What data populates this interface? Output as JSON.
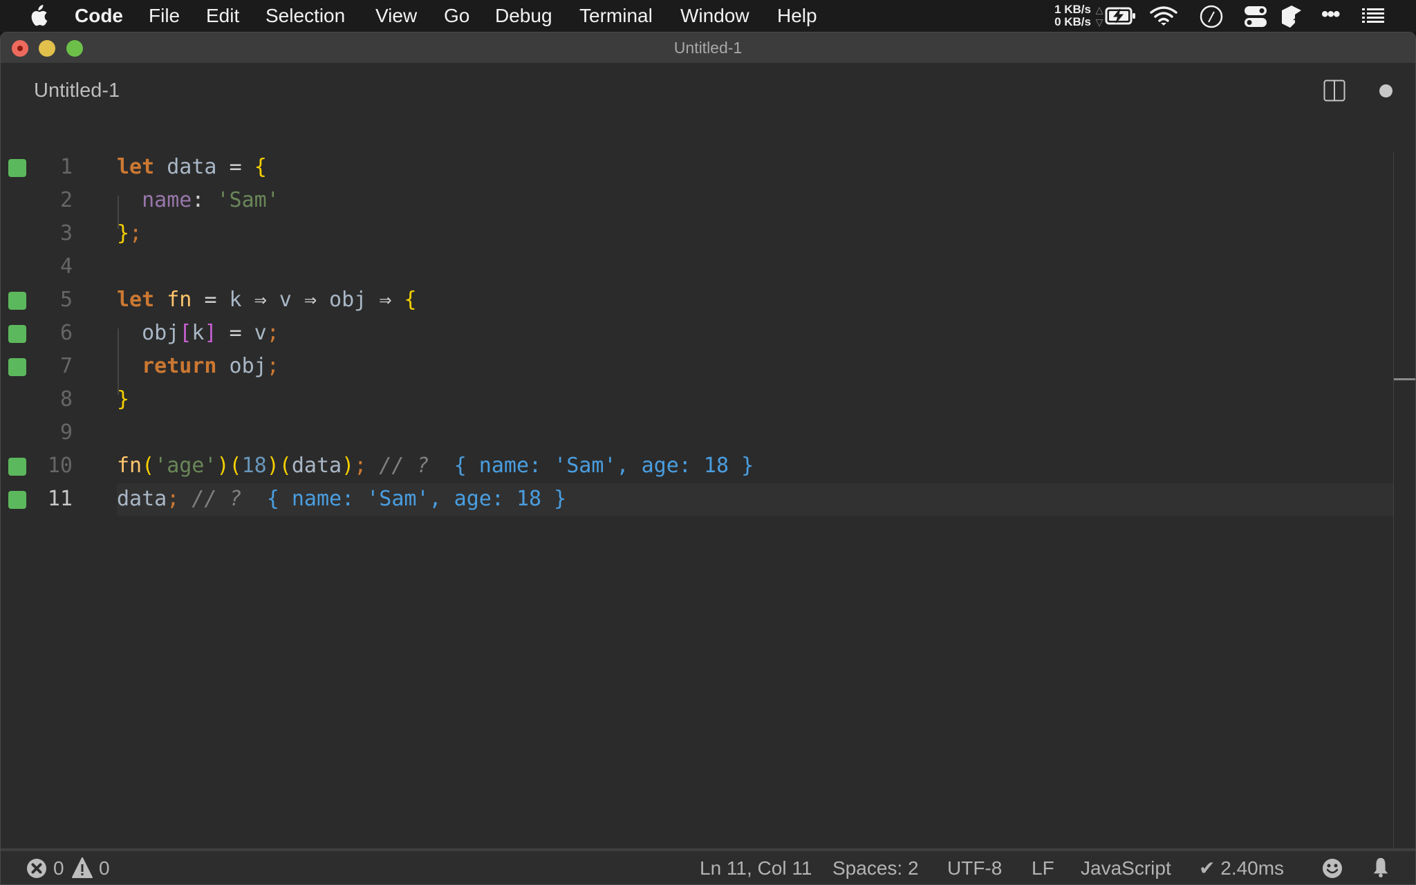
{
  "menubar": {
    "app_name": "Code",
    "items": [
      "File",
      "Edit",
      "Selection",
      "View",
      "Go",
      "Debug",
      "Terminal",
      "Window",
      "Help"
    ],
    "tray": {
      "net_up": "1 KB/s",
      "net_down": "0 KB/s",
      "icons": [
        "battery-charging-icon",
        "wifi-icon",
        "clock-icon",
        "control-center-icon",
        "cube-app-icon",
        "more-icon",
        "list-icon"
      ]
    }
  },
  "window": {
    "title": "Untitled-1"
  },
  "editor": {
    "tab_title": "Untitled-1",
    "dirty": true,
    "current_line": 11,
    "lines": [
      {
        "n": "1",
        "marker": true,
        "tokens": [
          [
            "kw",
            "let"
          ],
          [
            "var",
            " data "
          ],
          [
            "op",
            "="
          ],
          [
            "var",
            " "
          ],
          [
            "brace",
            "{"
          ]
        ]
      },
      {
        "n": "2",
        "marker": false,
        "tokens": [
          [
            "var",
            "  "
          ],
          [
            "prop",
            "name"
          ],
          [
            "op",
            ":"
          ],
          [
            "var",
            " "
          ],
          [
            "str",
            "'Sam'"
          ]
        ]
      },
      {
        "n": "3",
        "marker": false,
        "tokens": [
          [
            "brace",
            "}"
          ],
          [
            "semi",
            ";"
          ]
        ]
      },
      {
        "n": "4",
        "marker": false,
        "tokens": []
      },
      {
        "n": "5",
        "marker": true,
        "tokens": [
          [
            "kw",
            "let"
          ],
          [
            "var",
            " "
          ],
          [
            "fn",
            "fn"
          ],
          [
            "var",
            " "
          ],
          [
            "op",
            "="
          ],
          [
            "var",
            " k "
          ],
          [
            "op",
            "⇒"
          ],
          [
            "var",
            " v "
          ],
          [
            "op",
            "⇒"
          ],
          [
            "var",
            " obj "
          ],
          [
            "op",
            "⇒"
          ],
          [
            "var",
            " "
          ],
          [
            "brace",
            "{"
          ]
        ]
      },
      {
        "n": "6",
        "marker": true,
        "tokens": [
          [
            "var",
            "  obj"
          ],
          [
            "bracket",
            "["
          ],
          [
            "var",
            "k"
          ],
          [
            "bracket",
            "]"
          ],
          [
            "var",
            " "
          ],
          [
            "op",
            "="
          ],
          [
            "var",
            " v"
          ],
          [
            "semi",
            ";"
          ]
        ]
      },
      {
        "n": "7",
        "marker": true,
        "tokens": [
          [
            "var",
            "  "
          ],
          [
            "kw",
            "return"
          ],
          [
            "var",
            " obj"
          ],
          [
            "semi",
            ";"
          ]
        ]
      },
      {
        "n": "8",
        "marker": false,
        "tokens": [
          [
            "brace",
            "}"
          ]
        ]
      },
      {
        "n": "9",
        "marker": false,
        "tokens": []
      },
      {
        "n": "10",
        "marker": true,
        "tokens": [
          [
            "fn",
            "fn"
          ],
          [
            "brace",
            "("
          ],
          [
            "str",
            "'age'"
          ],
          [
            "brace",
            ")("
          ],
          [
            "num",
            "18"
          ],
          [
            "brace",
            ")("
          ],
          [
            "var",
            "data"
          ],
          [
            "brace",
            ")"
          ],
          [
            "semi",
            ";"
          ],
          [
            "var",
            " "
          ],
          [
            "comment",
            "// ?"
          ],
          [
            "var",
            "  "
          ],
          [
            "result",
            "{ name: 'Sam', age: 18 }"
          ]
        ]
      },
      {
        "n": "11",
        "marker": true,
        "tokens": [
          [
            "var",
            "data"
          ],
          [
            "semi",
            ";"
          ],
          [
            "var",
            " "
          ],
          [
            "comment",
            "// ?"
          ],
          [
            "var",
            "  "
          ],
          [
            "result",
            "{ name: 'Sam', age: 18 }"
          ]
        ]
      }
    ]
  },
  "statusbar": {
    "errors": "0",
    "warnings": "0",
    "position": "Ln 11, Col 11",
    "indent": "Spaces: 2",
    "encoding": "UTF-8",
    "eol": "LF",
    "language": "JavaScript",
    "timing": "✔ 2.40ms"
  },
  "colors": {
    "marker": "#5cb85c",
    "keyword": "#cc7832",
    "string": "#6a8759",
    "result": "#4a9ee0"
  }
}
